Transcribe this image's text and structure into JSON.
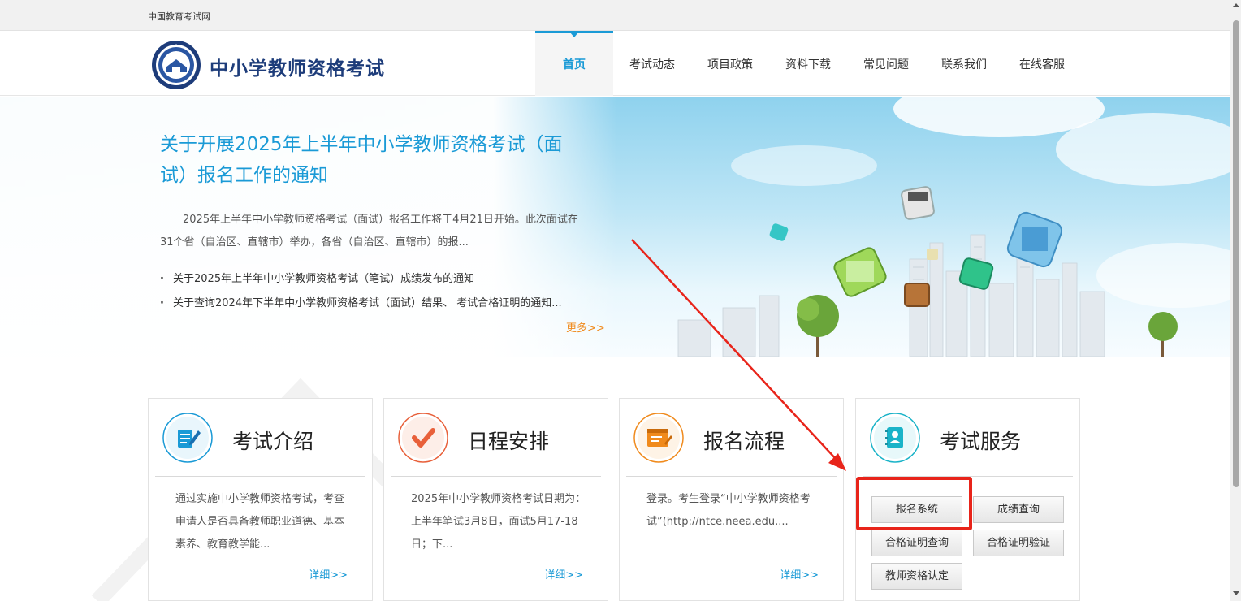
{
  "topbar": {
    "site_name": "中国教育考试网"
  },
  "header": {
    "logo_text": "中小学教师资格考试",
    "nav": [
      "首页",
      "考试动态",
      "项目政策",
      "资料下载",
      "常见问题",
      "联系我们",
      "在线客服"
    ]
  },
  "banner": {
    "headline": "关于开展2025年上半年中小学教师资格考试（面试）报名工作的通知",
    "summary": "2025年上半年中小学教师资格考试（面试）报名工作将于4月21日开始。此次面试在31个省（自治区、直辖市）举办，各省（自治区、直辖市）的报...",
    "news": [
      "关于2025年上半年中小学教师资格考试（笔试）成绩发布的通知",
      "关于查询2024年下半年中小学教师资格考试（面试）结果、 考试合格证明的通知..."
    ],
    "more": "更多>>"
  },
  "cards": [
    {
      "title": "考试介绍",
      "icon": "document-edit-icon",
      "desc": "通过实施中小学教师资格考试，考查申请人是否具备教师职业道德、基本素养、教育教学能...",
      "detail": "详细>>"
    },
    {
      "title": "日程安排",
      "icon": "checkmark-icon",
      "desc": "2025年中小学教师资格考试日期为：上半年笔试3月8日，面试5月17-18日；下...",
      "detail": "详细>>"
    },
    {
      "title": "报名流程",
      "icon": "form-list-icon",
      "desc": "登录。考生登录“中小学教师资格考试”(http://ntce.neea.edu....",
      "detail": "详细>>"
    },
    {
      "title": "考试服务",
      "icon": "contact-book-icon"
    }
  ],
  "services": [
    "报名系统",
    "成绩查询",
    "合格证明查询",
    "合格证明验证",
    "教师资格认定"
  ],
  "colors": {
    "accent": "#1a9ad6",
    "brand": "#1d3c7a",
    "more": "#f08a1c",
    "highlight": "#e8241a"
  }
}
